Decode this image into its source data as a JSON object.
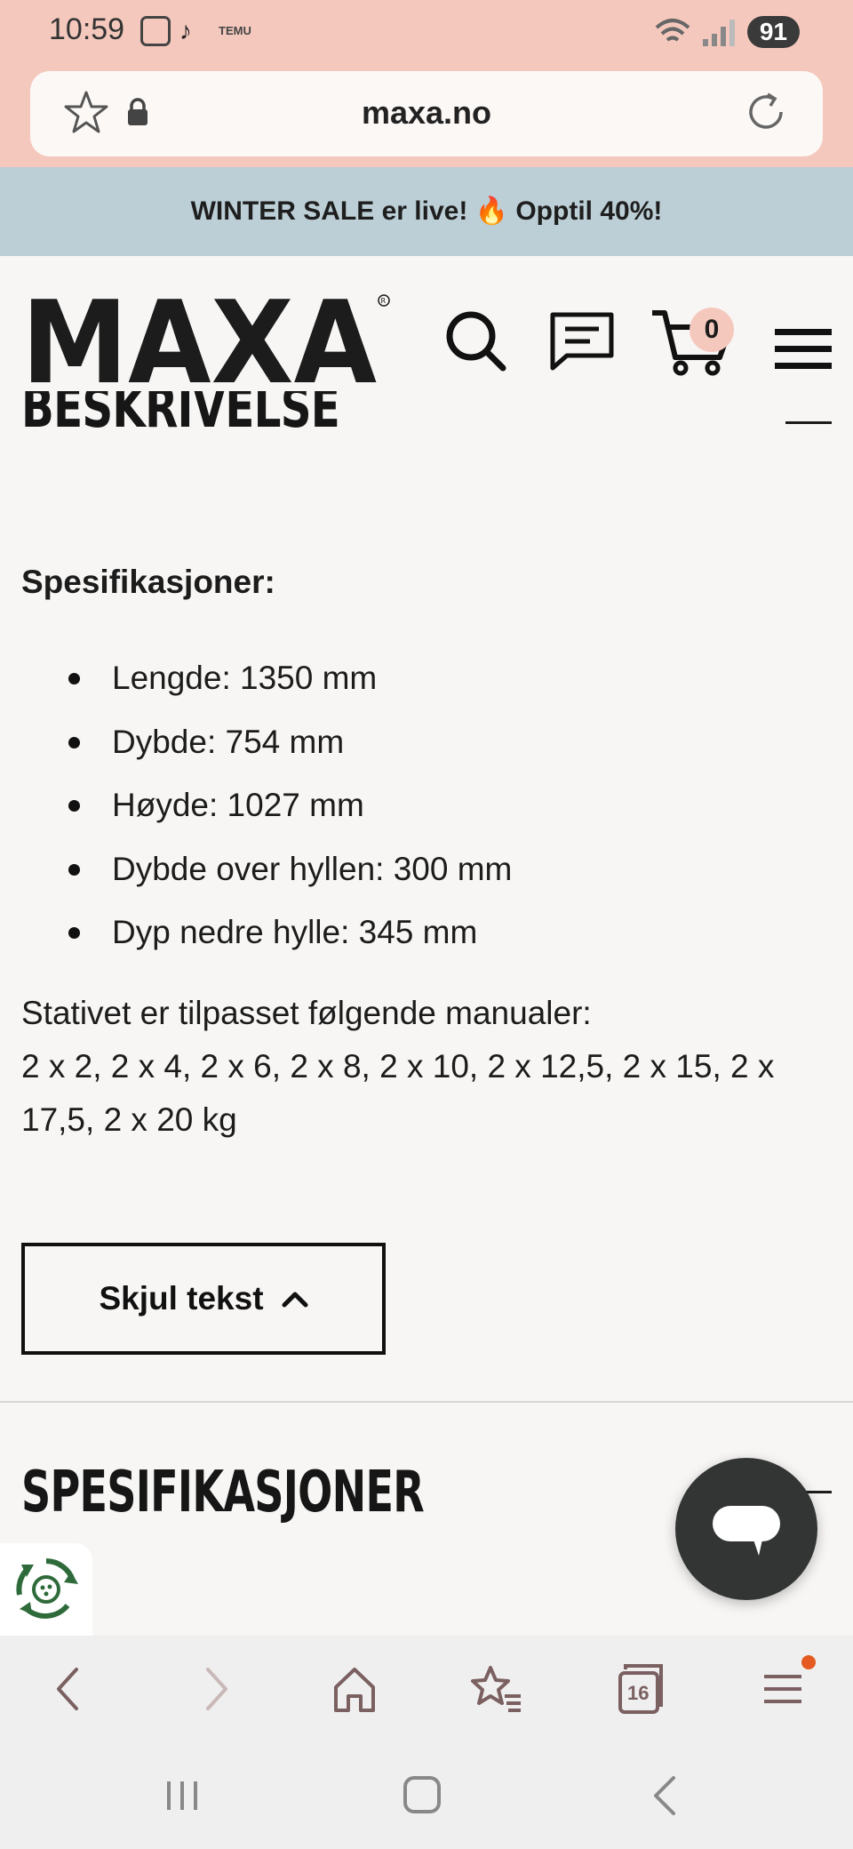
{
  "status_bar": {
    "time": "10:59",
    "temu_label": "TEMU",
    "battery": "91",
    "icons": [
      "screenshot-icon",
      "tiktok-icon",
      "temu-icon",
      "wifi-icon",
      "signal-icon",
      "battery-icon"
    ]
  },
  "browser": {
    "url": "maxa.no",
    "tabs_count": "16",
    "accent": "#f5c8bd"
  },
  "promo": {
    "text": "WINTER SALE er live! 🔥 Opptil 40%!"
  },
  "header": {
    "logo_text": "MAXA",
    "cart_count": "0"
  },
  "description": {
    "section_title": "BESKRIVELSE",
    "spec_heading": "Spesifikasjoner:",
    "specs": [
      "Lengde: 1350 mm",
      "Dybde: 754 mm",
      "Høyde: 1027 mm",
      "Dybde over hyllen: 300 mm",
      "Dyp nedre hylle: 345 mm"
    ],
    "paragraph_line1": "Stativet er tilpasset følgende manualer:",
    "paragraph_line2": "2 x 2, 2 x 4, 2 x 6, 2 x 8, 2 x 10, 2 x 12,5, 2 x 15, 2 x 17,5, 2 x 20 kg",
    "toggle_label": "Skjul tekst"
  },
  "specifications": {
    "section_title": "SPESIFIKASJONER"
  }
}
